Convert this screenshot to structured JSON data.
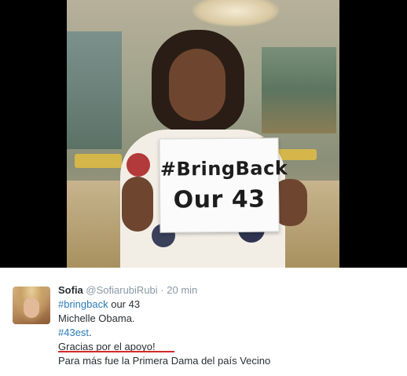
{
  "photo": {
    "sign": {
      "line1": "#BringBack",
      "line2": "Our 43"
    }
  },
  "tweet": {
    "author_name": "Sofia",
    "author_handle": "@SofiarubiRubi",
    "separator": "·",
    "time": "20 min",
    "lines": [
      {
        "hashtag": "#bringback",
        "text": " our 43"
      },
      {
        "hashtag": "",
        "text": "Michelle Obama."
      },
      {
        "hashtag": "#43est",
        "text": "."
      },
      {
        "hashtag": "",
        "text": "Gracias por el apoyo!"
      },
      {
        "hashtag": "",
        "text": "Para más fue la Primera Dama del país Vecino"
      }
    ]
  },
  "colors": {
    "hashtag": "#2b7bb9",
    "name": "#292f33",
    "meta": "#8899a6",
    "underline": "#d22a2a"
  }
}
